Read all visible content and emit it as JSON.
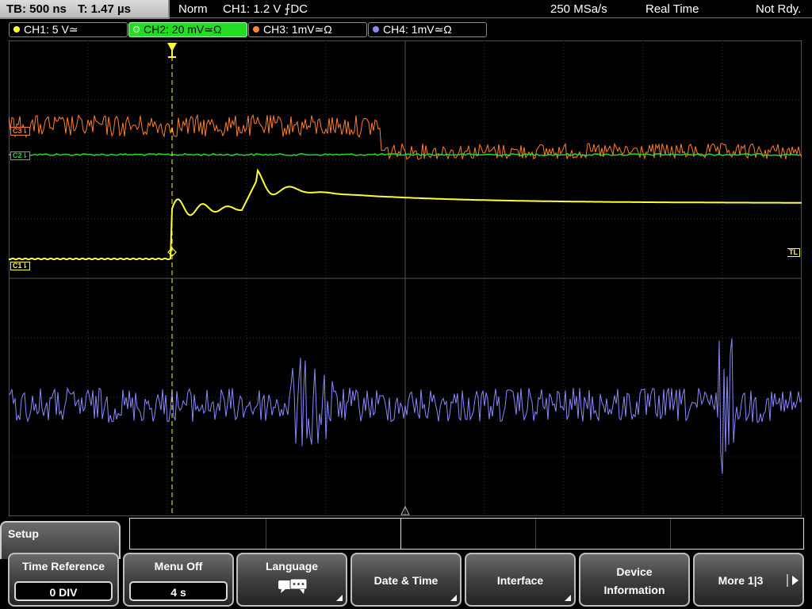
{
  "topbar": {
    "timebase": "TB: 500 ns",
    "trigger_time": "T: 1.47 µs",
    "trigger_mode": "Norm",
    "trigger_setting": "CH1: 1.2 V ⨍DC",
    "sample_rate": "250 MSa/s",
    "acq_mode": "Real Time",
    "status": "Not Rdy."
  },
  "channels": [
    {
      "label": "CH1: 5 V≃",
      "color": "#ffff33",
      "active": false
    },
    {
      "label": "CH2: 20 mV≃Ω",
      "color": "#22ee22",
      "active": true
    },
    {
      "label": "CH3: 1mV≃Ω",
      "color": "#ff8833",
      "active": false
    },
    {
      "label": "CH4: 1mV≃Ω",
      "color": "#8888ff",
      "active": false
    }
  ],
  "screen": {
    "ch1_marker": "C1⇂",
    "ch2_marker": "C2⇂",
    "ch3_marker": "C3⇂",
    "trigger_level_label": "TL",
    "trace_colors": {
      "ch1": "#ffff33",
      "ch2": "#22dd22",
      "ch3": "#ff7f2a",
      "ch4": "#8888ff"
    }
  },
  "menu": {
    "title": "Setup",
    "softkeys": [
      {
        "label": "Time Reference",
        "value": "0 DIV"
      },
      {
        "label": "Menu Off",
        "value": "4 s"
      },
      {
        "label": "Language",
        "icon": "speech-bubbles-icon"
      },
      {
        "label": "Date & Time"
      },
      {
        "label": "Interface"
      },
      {
        "label_line1": "Device",
        "label_line2": "Information"
      },
      {
        "label": "More 1|3"
      }
    ]
  }
}
